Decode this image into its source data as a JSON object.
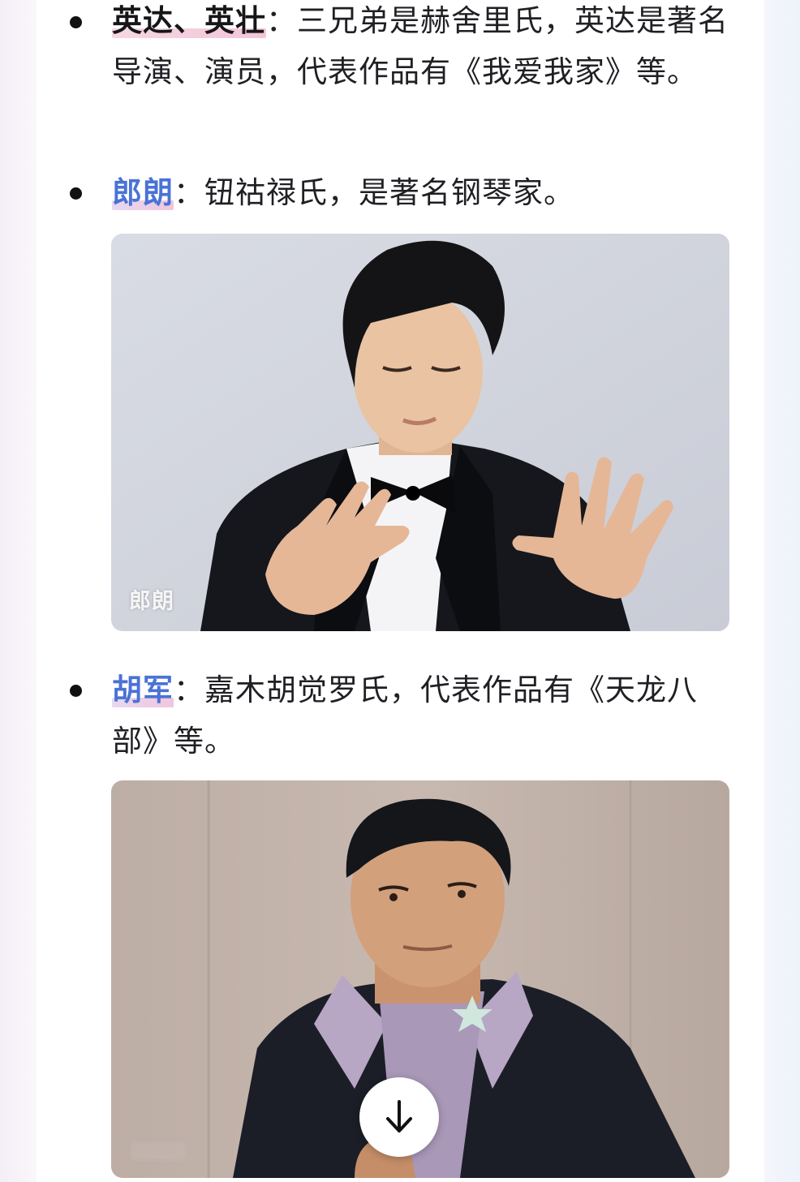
{
  "entries": [
    {
      "name": "英达、英壮",
      "colon": "：",
      "description": "三兄弟是赫舍里氏，英达是著名导演、演员，代表作品有《我爱我家》等。"
    },
    {
      "name": "郎朗",
      "colon": "：",
      "description": "钮祜禄氏，是著名钢琴家。",
      "photo_caption": "郎朗"
    },
    {
      "name": "胡军",
      "colon": "：",
      "description": "嘉木胡觉罗氏，代表作品有《天龙八部》等。"
    }
  ],
  "photo2": {
    "download_icon": "arrow-down-icon"
  },
  "colors": {
    "highlight_blue": "#4a72d6",
    "highlight_pink": "#f2c6d8",
    "bullet": "#111114"
  }
}
